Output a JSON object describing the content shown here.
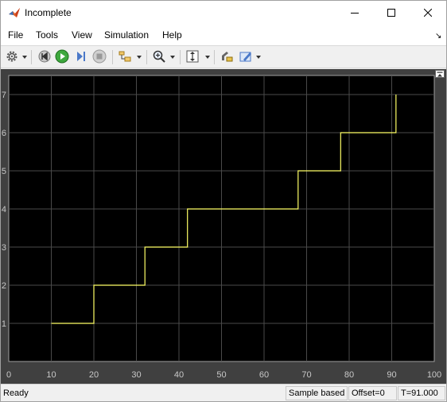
{
  "window": {
    "title": "Incomplete",
    "icon": "matlab-simulink-icon"
  },
  "menu": {
    "items": [
      "File",
      "Tools",
      "View",
      "Simulation",
      "Help"
    ]
  },
  "toolbar": {
    "icons": [
      "settings-gear-icon",
      "step-back-icon",
      "run-icon",
      "step-forward-icon",
      "stop-icon",
      "layout-icon",
      "zoom-icon",
      "autoscale-icon",
      "cursor-measure-icon",
      "highlight-icon"
    ]
  },
  "chart_data": {
    "type": "line",
    "style": "step",
    "background": "#000000",
    "line_color": "#ffff66",
    "grid": true,
    "xlim": [
      0,
      100
    ],
    "ylim": [
      0,
      7.5
    ],
    "xticks": [
      0,
      10,
      20,
      30,
      40,
      50,
      60,
      70,
      80,
      90,
      100
    ],
    "yticks": [
      1,
      2,
      3,
      4,
      5,
      6,
      7
    ],
    "x": [
      10,
      20,
      20,
      32,
      32,
      42,
      42,
      68,
      68,
      78,
      78,
      91,
      91
    ],
    "y": [
      1,
      1,
      2,
      2,
      3,
      3,
      4,
      4,
      5,
      5,
      6,
      6,
      7
    ]
  },
  "status": {
    "ready": "Ready",
    "mode": "Sample based",
    "offset": "Offset=0",
    "time": "T=91.000"
  }
}
